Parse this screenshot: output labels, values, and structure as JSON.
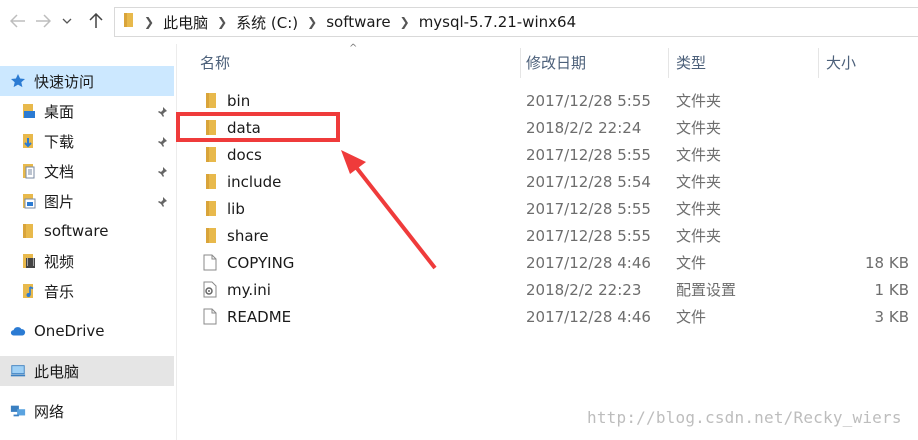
{
  "address_bar": {
    "crumbs": [
      "此电脑",
      "系统 (C:)",
      "software",
      "mysql-5.7.21-winx64"
    ]
  },
  "sidebar": {
    "quick_access": "快速访问",
    "items": [
      {
        "label": "桌面",
        "icon": "desktop-icon",
        "pinned": true
      },
      {
        "label": "下载",
        "icon": "download-icon",
        "pinned": true
      },
      {
        "label": "文档",
        "icon": "document-icon",
        "pinned": true
      },
      {
        "label": "图片",
        "icon": "picture-icon",
        "pinned": true
      },
      {
        "label": "software",
        "icon": "folder-icon",
        "pinned": false
      },
      {
        "label": "视频",
        "icon": "video-icon",
        "pinned": false
      },
      {
        "label": "音乐",
        "icon": "music-icon",
        "pinned": false
      }
    ],
    "onedrive": "OneDrive",
    "this_pc": "此电脑",
    "network": "网络"
  },
  "columns": {
    "name": "名称",
    "date": "修改日期",
    "type": "类型",
    "size": "大小"
  },
  "files": [
    {
      "name": "bin",
      "date": "2017/12/28 5:55",
      "type": "文件夹",
      "size": "",
      "kind": "folder"
    },
    {
      "name": "data",
      "date": "2018/2/2 22:24",
      "type": "文件夹",
      "size": "",
      "kind": "folder"
    },
    {
      "name": "docs",
      "date": "2017/12/28 5:55",
      "type": "文件夹",
      "size": "",
      "kind": "folder"
    },
    {
      "name": "include",
      "date": "2017/12/28 5:54",
      "type": "文件夹",
      "size": "",
      "kind": "folder"
    },
    {
      "name": "lib",
      "date": "2017/12/28 5:55",
      "type": "文件夹",
      "size": "",
      "kind": "folder"
    },
    {
      "name": "share",
      "date": "2017/12/28 5:55",
      "type": "文件夹",
      "size": "",
      "kind": "folder"
    },
    {
      "name": "COPYING",
      "date": "2017/12/28 4:46",
      "type": "文件",
      "size": "18 KB",
      "kind": "file"
    },
    {
      "name": "my.ini",
      "date": "2018/2/2 22:23",
      "type": "配置设置",
      "size": "1 KB",
      "kind": "ini"
    },
    {
      "name": "README",
      "date": "2017/12/28 4:46",
      "type": "文件",
      "size": "3 KB",
      "kind": "file"
    }
  ],
  "watermark": "http://blog.csdn.net/Recky_wiers",
  "colors": {
    "annotation": "#ef3b3b",
    "folder": "#e8b94c",
    "selected": "#e5e5e5",
    "header_text": "#4c607a"
  }
}
